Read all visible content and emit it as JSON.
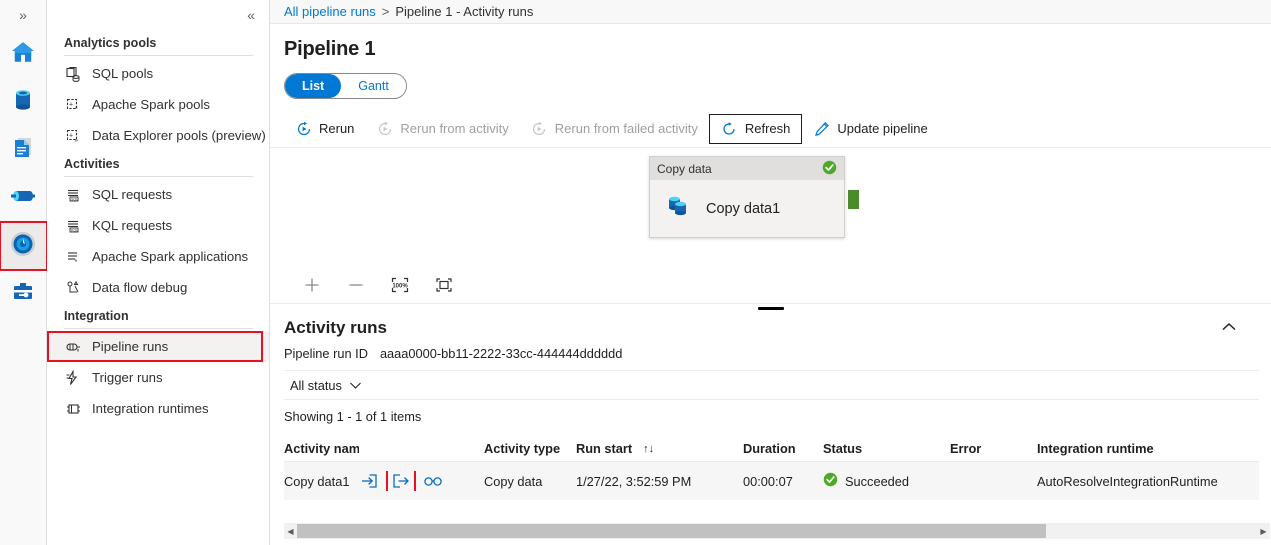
{
  "rail": {
    "expand_label": "»",
    "items": [
      {
        "name": "home",
        "icon": "home-icon"
      },
      {
        "name": "data",
        "icon": "database-icon"
      },
      {
        "name": "develop",
        "icon": "document-icon"
      },
      {
        "name": "integrate",
        "icon": "pipeline-icon"
      },
      {
        "name": "monitor",
        "icon": "monitor-gauge-icon",
        "selected": true,
        "highlighted": true
      },
      {
        "name": "manage",
        "icon": "toolbox-icon"
      }
    ]
  },
  "nav": {
    "collapse_label": "«",
    "groups": [
      {
        "title": "Analytics pools",
        "items": [
          {
            "label": "SQL pools",
            "icon": "sql-pools-icon"
          },
          {
            "label": "Apache Spark pools",
            "icon": "spark-pools-icon"
          },
          {
            "label": "Data Explorer pools (preview)",
            "icon": "data-explorer-pools-icon"
          }
        ]
      },
      {
        "title": "Activities",
        "items": [
          {
            "label": "SQL requests",
            "icon": "sql-requests-icon"
          },
          {
            "label": "KQL requests",
            "icon": "kql-requests-icon"
          },
          {
            "label": "Apache Spark applications",
            "icon": "spark-applications-icon"
          },
          {
            "label": "Data flow debug",
            "icon": "data-flow-debug-icon"
          }
        ]
      },
      {
        "title": "Integration",
        "items": [
          {
            "label": "Pipeline runs",
            "icon": "pipeline-runs-icon",
            "selected": true,
            "highlighted": true
          },
          {
            "label": "Trigger runs",
            "icon": "trigger-runs-icon"
          },
          {
            "label": "Integration runtimes",
            "icon": "integration-runtimes-icon"
          }
        ]
      }
    ]
  },
  "breadcrumb": {
    "root": "All pipeline runs",
    "separator": ">",
    "current": "Pipeline 1 - Activity runs"
  },
  "page": {
    "title": "Pipeline 1"
  },
  "pivot": {
    "list": "List",
    "gantt": "Gantt",
    "active": "List"
  },
  "toolbar": {
    "rerun": "Rerun",
    "rerun_from_activity": "Rerun from activity",
    "rerun_from_failed_activity": "Rerun from failed activity",
    "refresh": "Refresh",
    "update_pipeline": "Update pipeline"
  },
  "canvas": {
    "node": {
      "header": "Copy data",
      "label": "Copy data1",
      "status": "succeeded"
    },
    "controls": {
      "zoom_in": "+",
      "zoom_out": "−",
      "zoom_to_100": "100%",
      "fit_to_screen": "fit"
    }
  },
  "activity_runs": {
    "title": "Activity runs",
    "collapse_icon": "chevron-up-icon",
    "run_id_label": "Pipeline run ID",
    "run_id_value": "aaaa0000-bb11-2222-33cc-444444dddddd",
    "status_filter": "All status",
    "showing": "Showing 1 - 1 of 1 items",
    "columns": [
      "Activity name",
      "",
      "Activity type",
      "Run start",
      "Duration",
      "Status",
      "Error",
      "Integration runtime"
    ],
    "sort_indicator": "↑↓",
    "rows": [
      {
        "activity_name": "Copy data1",
        "icons": [
          "input-icon",
          "output-icon",
          "details-glasses-icon"
        ],
        "highlighted_icon": "output-icon",
        "activity_type": "Copy data",
        "run_start": "1/27/22, 3:52:59 PM",
        "duration": "00:00:07",
        "status": "Succeeded",
        "error": "",
        "integration_runtime": "AutoResolveIntegrationRuntime"
      }
    ]
  },
  "colors": {
    "accent": "#0078d4",
    "success": "#107c10",
    "highlight_box": "#e81123",
    "node_port": "#4c8b2b"
  }
}
